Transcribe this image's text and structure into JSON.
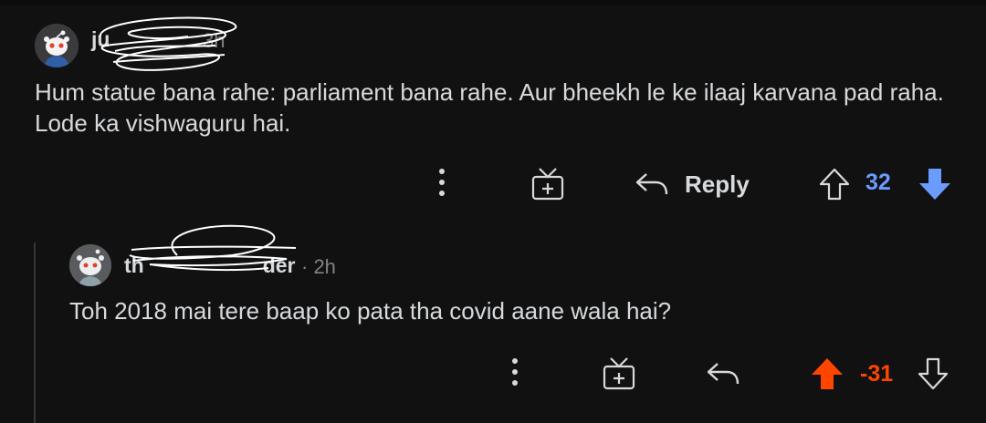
{
  "comments": [
    {
      "username": "ju",
      "timestamp": "3h",
      "body": "Hum statue bana rahe: parliament bana rahe. Aur bheekh le ke ilaaj karvana pad raha. Lode ka vishwaguru hai.",
      "reply_label": "Reply",
      "score": "32",
      "vote_state": "downvoted",
      "vote_color": "#6a9bff"
    },
    {
      "username": "th",
      "username_tail": "der",
      "timestamp": "· 2h",
      "body": "Toh 2018 mai tere baap ko pata tha covid aane wala hai?",
      "score": "-31",
      "vote_state": "upvoted",
      "vote_color": "#ff4500"
    }
  ],
  "icons": [
    "more-options-icon",
    "award-gift-icon",
    "reply-arrow-icon",
    "upvote-arrow-icon",
    "downvote-arrow-icon"
  ]
}
